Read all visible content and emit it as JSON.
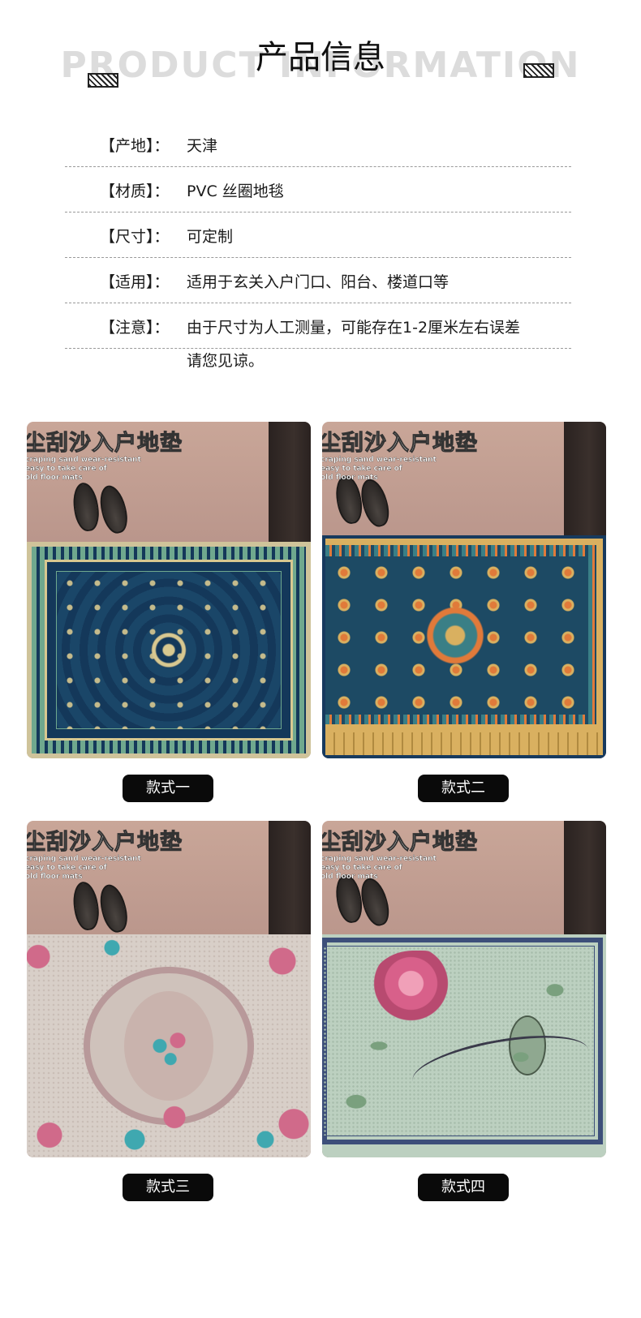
{
  "header": {
    "title": "产品信息",
    "bg_title": "PRODUCT INFORMATION"
  },
  "info": [
    {
      "label": "【产地】：",
      "value": "天津"
    },
    {
      "label": "【材质】：",
      "value": "PVC 丝圈地毯"
    },
    {
      "label": "【尺寸】：",
      "value": "可定制"
    },
    {
      "label": "【适用】：",
      "value": "适用于玄关入户门口、阳台、楼道口等"
    },
    {
      "label": "【注意】：",
      "value": "由于尺寸为人工测量，可能存在1-2厘米左右误差"
    }
  ],
  "note_continuation": "请您见谅。",
  "products": [
    {
      "overlay_title": "尘刮沙入户地垫",
      "overlay_sub": [
        "craping sand wear-resistant",
        "easy to take care of",
        "old floor mats"
      ],
      "caption": "款式一",
      "rug_colors": [
        "#14385a",
        "#d8c890",
        "#6fa88e"
      ]
    },
    {
      "overlay_title": "尘刮沙入户地垫",
      "overlay_sub": [
        "craping sand wear-resistant",
        "easy to take care of",
        "old floor mats"
      ],
      "caption": "款式二",
      "rug_colors": [
        "#1d4a64",
        "#d9b060",
        "#e07a3a"
      ]
    },
    {
      "overlay_title": "尘刮沙入户地垫",
      "overlay_sub": [
        "craping sand wear-resistant",
        "easy to take care of",
        "old floor mats"
      ],
      "caption": "款式三",
      "rug_colors": [
        "#d8cfc8",
        "#a8868a",
        "#d06a8a"
      ]
    },
    {
      "overlay_title": "尘刮沙入户地垫",
      "overlay_sub": [
        "craping sand wear-resistant",
        "easy to take care of",
        "old floor mats"
      ],
      "caption": "款式四",
      "rug_colors": [
        "#bcd0c0",
        "#3d4f7a",
        "#d8608a"
      ]
    }
  ]
}
